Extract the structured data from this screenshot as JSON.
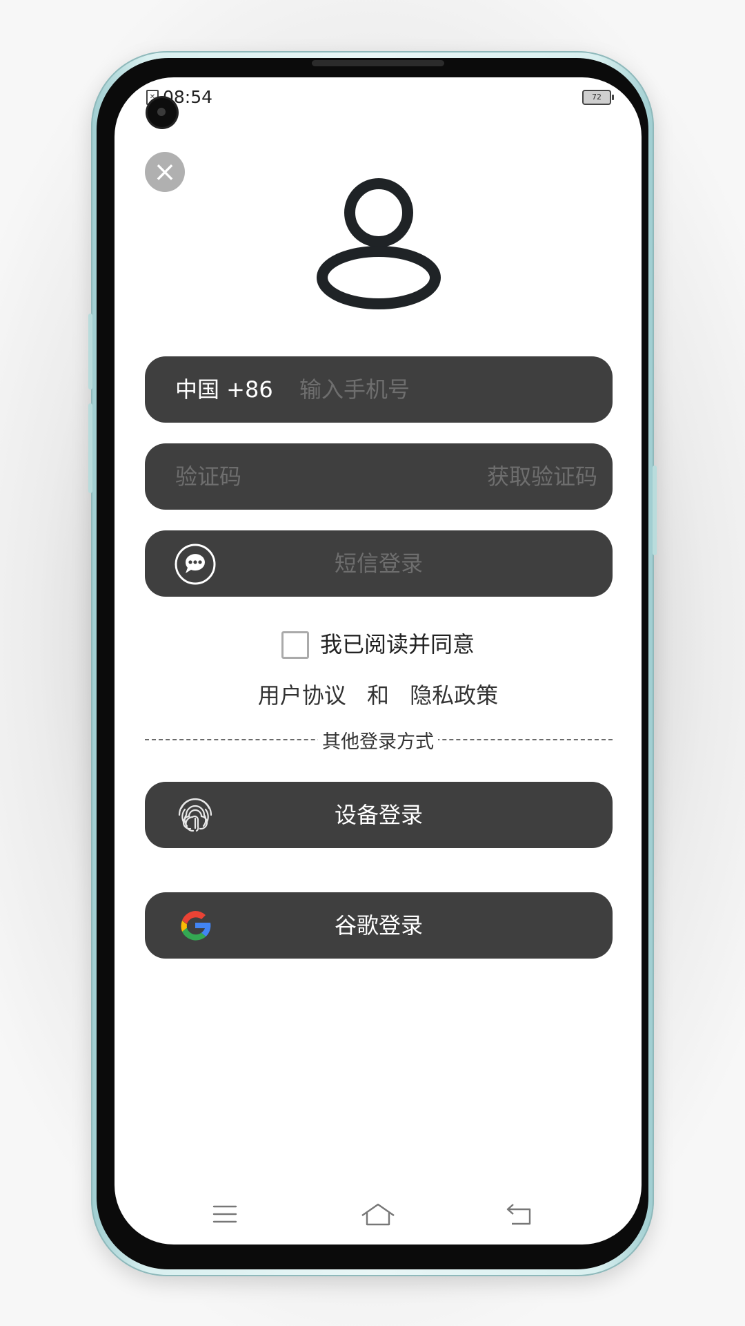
{
  "status_bar": {
    "time": "08:54",
    "battery": "72"
  },
  "login": {
    "country_code": "中国 +86",
    "phone_placeholder": "输入手机号",
    "code_placeholder": "验证码",
    "get_code_label": "获取验证码",
    "sms_login_label": "短信登录",
    "agree_text": "我已阅读并同意",
    "user_agreement": "用户协议",
    "and_text": "和",
    "privacy_policy": "隐私政策",
    "other_methods": "其他登录方式",
    "device_login_label": "设备登录",
    "google_login_label": "谷歌登录"
  },
  "nav_bar": {
    "icons": [
      "menu-icon",
      "home-icon",
      "back-icon"
    ]
  },
  "colors": {
    "bar_bg": "#3f3f3f",
    "placeholder": "#6e6e6e",
    "google_blue": "#4285F4",
    "google_red": "#EA4335",
    "google_yellow": "#FBBC05",
    "google_green": "#34A853"
  },
  "icons": {
    "close": "close-icon",
    "avatar": "user-avatar-icon",
    "chat": "chat-bubble-icon",
    "fingerprint": "fingerprint-icon",
    "google": "google-logo-icon"
  }
}
